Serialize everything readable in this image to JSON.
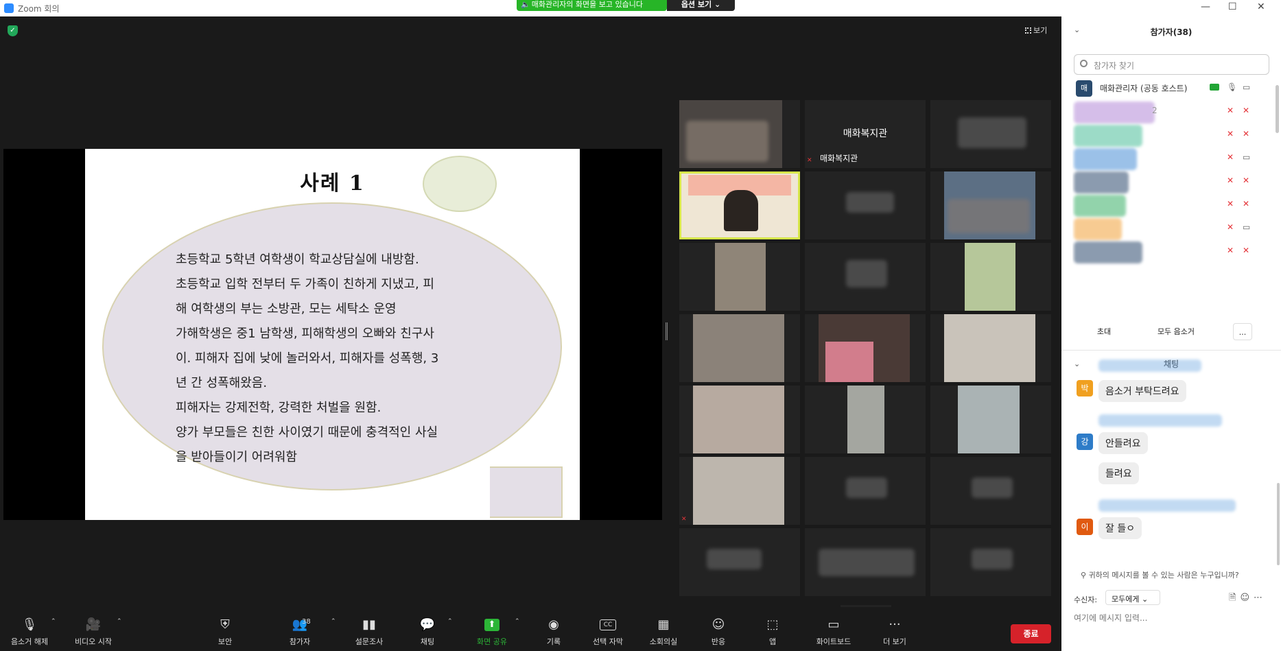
{
  "window": {
    "title": "Zoom 회의",
    "min": "—",
    "max": "☐",
    "close": "✕"
  },
  "share_banner": {
    "text": "매화관리자의 화면을 보고 있습니다",
    "options_label": "옵션 보기 ⌄"
  },
  "view_button": {
    "label": "보기"
  },
  "slide": {
    "title": "사례 1",
    "lines": [
      "초등학교 5학년 여학생이 학교상담실에 내방함.",
      "초등학교 입학 전부터 두 가족이 친하게 지냈고, 피",
      "해 여학생의 부는 소방관, 모는 세탁소 운영",
      "가해학생은 중1 남학생, 피해학생의 오빠와 친구사",
      "이. 피해자 집에 낮에 놀러와서, 피해자를 성폭행, 3",
      "년 간 성폭해왔음.",
      "피해자는 강제전학, 강력한 처벌을 원함.",
      "양가 부모들은 친한 사이였기 때문에 충격적인 사실",
      "을 받아들이기 어려워함"
    ]
  },
  "gallery": {
    "named_tile_title": "매화복지관",
    "named_tile_label": "매화복지관"
  },
  "toolbar": {
    "unmute": "음소거 해제",
    "start_video": "비디오 시작",
    "security": "보안",
    "participants": "참가자",
    "participants_count": "38",
    "polls": "설문조사",
    "chat": "채팅",
    "share_screen": "화면 공유",
    "record": "기록",
    "captions": "선택 자막",
    "captions_icon": "CC",
    "breakout": "소회의실",
    "reactions": "반응",
    "apps": "앱",
    "whiteboard": "화이트보드",
    "more": "더 보기",
    "end": "종료"
  },
  "panel": {
    "participants_header": "참가자(38)",
    "search_placeholder": "참가자 찾기",
    "host": {
      "avatar": "매",
      "name": "매화관리자 (공동 호스트)"
    },
    "partial_text": "2",
    "invite": "초대",
    "mute_all": "모두 음소거",
    "more": "...",
    "chat_header": "채팅",
    "messages": [
      {
        "avatar": "박",
        "color": "#f0a020",
        "texts": [
          "음소거 부탁드려요"
        ]
      },
      {
        "avatar": "강",
        "color": "#2e7cc8",
        "texts": [
          "안들려요",
          "들려요"
        ]
      },
      {
        "avatar": "이",
        "color": "#e05a10",
        "texts": [
          "잘 들ㅇ"
        ]
      }
    ],
    "who_can_see": "귀하의 메시지를 볼 수 있는 사람은 누구입니까?",
    "recipient_label": "수신자:",
    "recipient_value": "모두에게 ⌄",
    "input_placeholder": "여기에 메시지 입력..."
  }
}
